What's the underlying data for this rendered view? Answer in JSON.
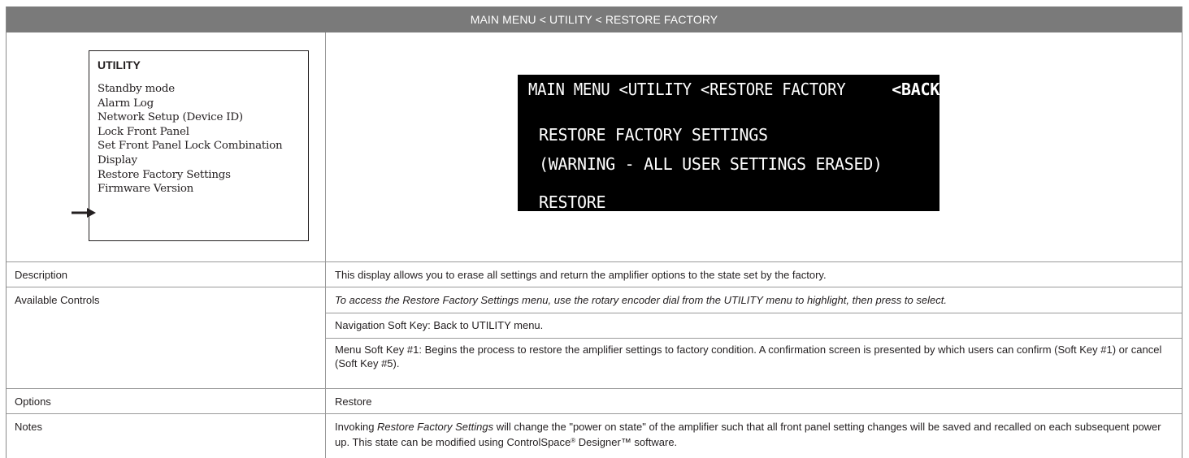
{
  "header": {
    "title": "MAIN MENU < UTILITY < RESTORE FACTORY"
  },
  "utility_menu": {
    "title": "UTILITY",
    "items": [
      "Standby mode",
      "Alarm Log",
      "Network Setup (Device ID)",
      "Lock Front Panel",
      "Set Front Panel Lock Combination",
      "Display",
      "Restore Factory Settings",
      "Firmware Version"
    ],
    "selected_item": "Restore Factory Settings"
  },
  "lcd": {
    "breadcrumb": "MAIN MENU <UTILITY <RESTORE FACTORY",
    "back": "<BACK",
    "line1": "RESTORE FACTORY SETTINGS",
    "line2": "(WARNING - ALL USER SETTINGS ERASED)",
    "action": "RESTORE"
  },
  "rows": {
    "description": {
      "label": "Description",
      "text": "This display allows you to erase all settings and return the amplifier options to the state set by the factory."
    },
    "controls": {
      "label": "Available Controls",
      "p1": "To access the Restore Factory Settings menu, use the rotary encoder dial from the UTILITY menu to highlight, then press to select.",
      "p2": "Navigation Soft Key: Back to UTILITY menu.",
      "p3": "Menu Soft Key #1: Begins the process to restore the amplifier settings to factory condition. A confirmation screen is presented by which users can confirm (Soft Key #1) or cancel (Soft Key #5)."
    },
    "options": {
      "label": "Options",
      "text": "Restore"
    },
    "notes": {
      "label": "Notes",
      "pre": "Invoking ",
      "em": "Restore Factory Settings",
      "mid": " will change the \"power on state\" of the amplifier such that all front panel setting changes will be saved and recalled on each subsequent power up. This state can be modified using ControlSpace",
      "reg": "®",
      "brand2": " Designer",
      "tm": "™",
      "post": " software."
    }
  }
}
